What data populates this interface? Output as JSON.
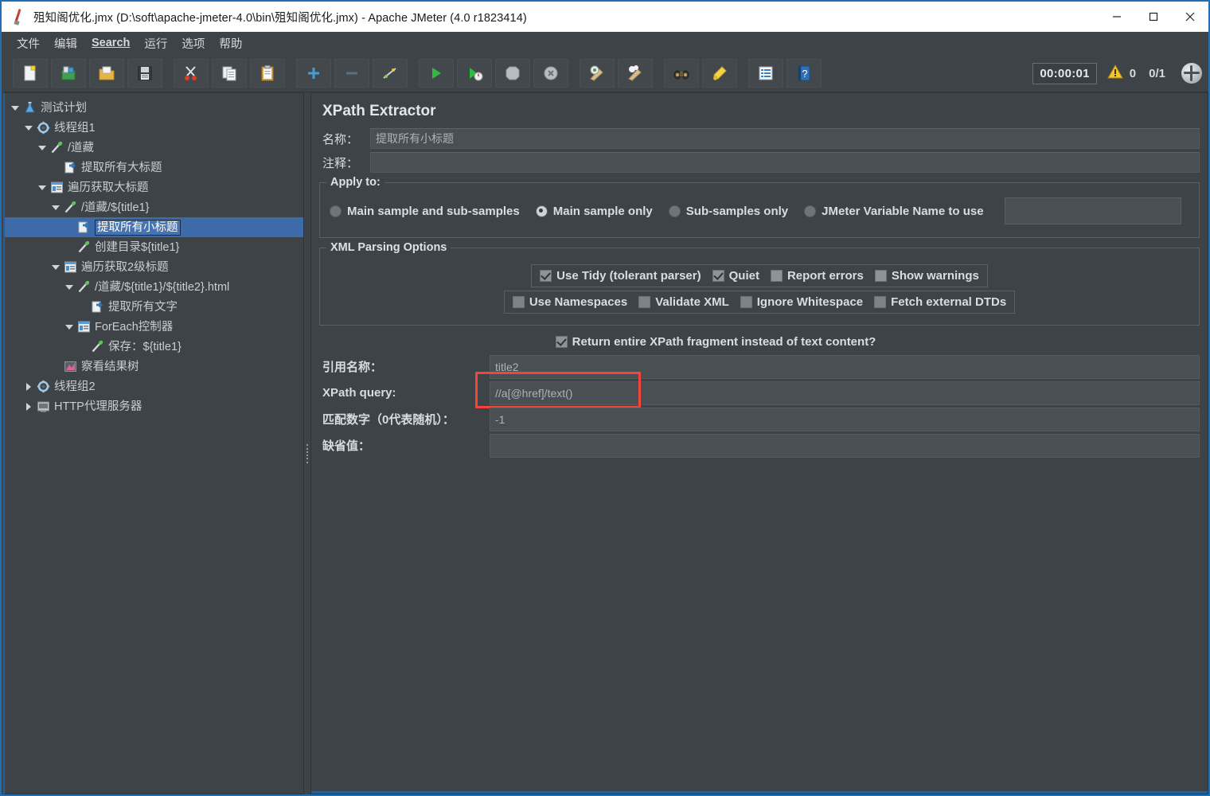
{
  "window": {
    "title": "殂知阁优化.jmx (D:\\soft\\apache-jmeter-4.0\\bin\\殂知阁优化.jmx) - Apache JMeter (4.0 r1823414)",
    "minimize_label": "minimize",
    "maximize_label": "maximize",
    "close_label": "close"
  },
  "menu": {
    "items": [
      {
        "label": "文件",
        "underlined": false
      },
      {
        "label": "编辑",
        "underlined": false
      },
      {
        "label": "Search",
        "underlined": true
      },
      {
        "label": "运行",
        "underlined": false
      },
      {
        "label": "选项",
        "underlined": false
      },
      {
        "label": "帮助",
        "underlined": false
      }
    ]
  },
  "toolbar": {
    "buttons": [
      {
        "icon": "new-file-icon",
        "name": "new-button"
      },
      {
        "icon": "templates-icon",
        "name": "templates-button"
      },
      {
        "icon": "open-folder-icon",
        "name": "open-button"
      },
      {
        "icon": "save-floppy-icon",
        "name": "save-button"
      },
      {
        "icon": "scissors-icon",
        "name": "cut-button"
      },
      {
        "icon": "copy-icon",
        "name": "copy-button"
      },
      {
        "icon": "paste-clipboard-icon",
        "name": "paste-button"
      },
      {
        "icon": "plus-icon",
        "name": "expand-all-button"
      },
      {
        "icon": "minus-icon",
        "name": "collapse-all-button"
      },
      {
        "icon": "toggle-icon",
        "name": "toggle-button"
      },
      {
        "icon": "start-play-icon",
        "name": "start-button"
      },
      {
        "icon": "start-no-timers-icon",
        "name": "start-no-pauses-button"
      },
      {
        "icon": "stop-icon",
        "name": "stop-button"
      },
      {
        "icon": "shutdown-icon",
        "name": "shutdown-button"
      },
      {
        "icon": "clear-icon",
        "name": "clear-button"
      },
      {
        "icon": "clear-all-icon",
        "name": "clear-all-button"
      },
      {
        "icon": "search-binoculars-icon",
        "name": "search-button"
      },
      {
        "icon": "reset-search-icon",
        "name": "reset-search-button"
      },
      {
        "icon": "function-helper-icon",
        "name": "function-helper-button"
      },
      {
        "icon": "help-icon",
        "name": "help-button"
      }
    ],
    "timer": "00:00:01",
    "warnings_count": "0",
    "threads_count": "0/1"
  },
  "tree": {
    "nodes": [
      {
        "label": "测试计划",
        "indent": 0,
        "toggle": "open",
        "icon": "test-plan-icon",
        "selected": false
      },
      {
        "label": "线程组1",
        "indent": 1,
        "toggle": "open",
        "icon": "thread-group-icon",
        "selected": false
      },
      {
        "label": "/道藏",
        "indent": 2,
        "toggle": "open",
        "icon": "http-sampler-icon",
        "selected": false
      },
      {
        "label": "提取所有大标题",
        "indent": 3,
        "toggle": "none",
        "icon": "post-processor-icon",
        "selected": false
      },
      {
        "label": "遍历获取大标题",
        "indent": 2,
        "toggle": "open",
        "icon": "controller-icon",
        "selected": false
      },
      {
        "label": "/道藏/${title1}",
        "indent": 3,
        "toggle": "open",
        "icon": "http-sampler-icon",
        "selected": false
      },
      {
        "label": "提取所有小标题",
        "indent": 4,
        "toggle": "none",
        "icon": "post-processor-icon",
        "selected": true
      },
      {
        "label": "创建目录${title1}",
        "indent": 4,
        "toggle": "none",
        "icon": "http-sampler-icon",
        "selected": false
      },
      {
        "label": "遍历获取2级标题",
        "indent": 3,
        "toggle": "open",
        "icon": "controller-icon",
        "selected": false
      },
      {
        "label": "/道藏/${title1}/${title2}.html",
        "indent": 4,
        "toggle": "open",
        "icon": "http-sampler-icon",
        "selected": false
      },
      {
        "label": "提取所有文字",
        "indent": 5,
        "toggle": "none",
        "icon": "post-processor-icon",
        "selected": false
      },
      {
        "label": "ForEach控制器",
        "indent": 4,
        "toggle": "open",
        "icon": "controller-icon",
        "selected": false
      },
      {
        "label": "保存：${title1}",
        "indent": 5,
        "toggle": "none",
        "icon": "http-sampler-icon",
        "selected": false
      },
      {
        "label": "察看结果树",
        "indent": 3,
        "toggle": "none",
        "icon": "view-results-tree-icon",
        "selected": false
      },
      {
        "label": "线程组2",
        "indent": 1,
        "toggle": "closed",
        "icon": "thread-group-icon",
        "selected": false
      },
      {
        "label": "HTTP代理服务器",
        "indent": 1,
        "toggle": "closed",
        "icon": "proxy-server-icon",
        "selected": false
      }
    ]
  },
  "panel": {
    "title": "XPath Extractor",
    "name_label": "名称：",
    "name_value": "提取所有小标题",
    "comment_label": "注释：",
    "comment_value": "",
    "apply_to": {
      "title": "Apply to:",
      "options": [
        {
          "label": "Main sample and sub-samples",
          "selected": false
        },
        {
          "label": "Main sample only",
          "selected": true
        },
        {
          "label": "Sub-samples only",
          "selected": false
        },
        {
          "label": "JMeter Variable Name to use",
          "selected": false
        }
      ],
      "variable_value": ""
    },
    "xml_parsing": {
      "title": "XML Parsing Options",
      "row1": [
        {
          "label": "Use Tidy (tolerant parser)",
          "checked": true
        },
        {
          "label": "Quiet",
          "checked": true
        },
        {
          "label": "Report errors",
          "checked": false
        },
        {
          "label": "Show warnings",
          "checked": false
        }
      ],
      "row2": [
        {
          "label": "Use Namespaces",
          "checked": false
        },
        {
          "label": "Validate XML",
          "checked": false
        },
        {
          "label": "Ignore Whitespace",
          "checked": false
        },
        {
          "label": "Fetch external DTDs",
          "checked": false
        }
      ]
    },
    "return_fragment": {
      "label": "Return entire XPath fragment instead of text content?",
      "checked": true
    },
    "fields": [
      {
        "label": "引用名称：",
        "value": "title2",
        "highlighted": false
      },
      {
        "label": "XPath query:",
        "value": "//a[@href]/text()",
        "highlighted": true
      },
      {
        "label": "匹配数字（0代表随机）：",
        "value": "-1",
        "highlighted": false
      },
      {
        "label": "缺省值：",
        "value": "",
        "highlighted": false
      }
    ]
  },
  "colors": {
    "app_bg": "#3e4347",
    "field_bg": "#4a4f53",
    "selection_blue": "#3d6aa8",
    "border_blue": "#1f6fb2",
    "highlight_red": "#f5443a",
    "text": "#d9dcdf"
  }
}
